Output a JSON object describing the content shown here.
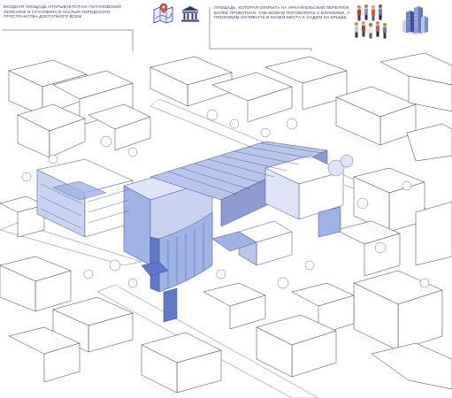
{
  "annotations": {
    "left": "ВХОДНАЯ ПЛОЩАДЬ ОТКРЫВАЕТСЯ НА ПОТАПОВСКИЙ ПЕРЕУЛОК И СТАНОВИТСЯ ЧАСТЬЮ ГОРОДСКОГО ПРОСТРАНСТВА ДОСТУПНОГО ВСЕМ.",
    "right": "ПЛОЩАДЬ, КОТОРАЯ ОТКРЫТА НА АРХАНГЕЛЬСКИЙ ПЕРЕУЛОК БОЛЕЕ ПРИВАТНАЯ. ТАМ МОЖНО ПОГОВОРИТЬ С БЛИЗКИМИ, А ПРОХОЖИМ ЗАГЛЯНУТЬ В МУЗЕЙ МЕСТА С САДОМ НА КРЫШЕ."
  },
  "icons": [
    "map-pin-icon",
    "museum-building-icon",
    "people-group-icon",
    "city-towers-icon"
  ],
  "colors": {
    "text": "#2f3a74",
    "accent_blue": "#9fb3e6",
    "accent_blue_dark": "#5f79c8",
    "line": "#444444",
    "tree": "#8a92a8"
  }
}
